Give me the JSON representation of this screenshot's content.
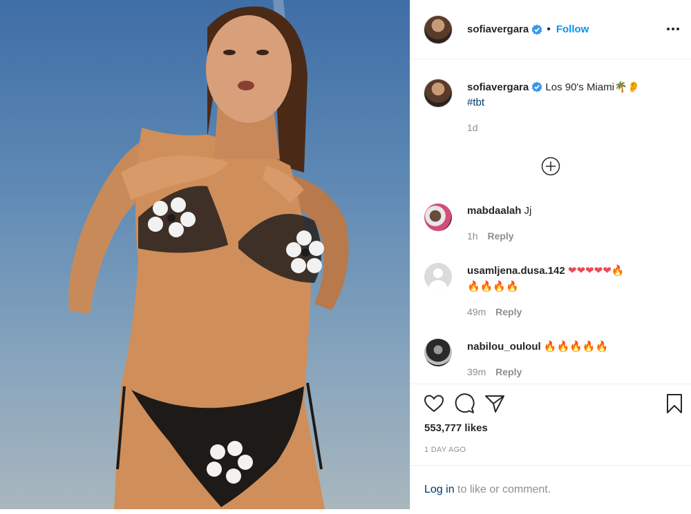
{
  "post": {
    "author": {
      "username": "sofiavergara",
      "verified": true,
      "follow_label": "Follow",
      "separator": "•"
    },
    "caption": {
      "text": "Los 90's Miami",
      "emojis": "🌴👂",
      "hashtag": "#tbt",
      "time": "1d"
    },
    "comments": [
      {
        "username": "mabdaalah",
        "text": "Jj",
        "time": "1h",
        "reply_label": "Reply"
      },
      {
        "username": "usamljena.dusa.142",
        "text": "❤❤❤❤❤🔥",
        "text2": "🔥🔥🔥🔥",
        "time": "49m",
        "reply_label": "Reply"
      },
      {
        "username": "nabilou_ouloul",
        "text": "🔥🔥🔥🔥🔥",
        "time": "39m",
        "reply_label": "Reply"
      }
    ],
    "likes": "553,777 likes",
    "date": "1 DAY AGO",
    "login": {
      "link": "Log in",
      "rest": " to like or comment."
    }
  },
  "colors": {
    "accent": "#0095f6",
    "verified": "#3897f0",
    "hashtag": "#00376b",
    "muted": "#8e8e8e",
    "heart": "#ed4956",
    "fire": "#f77b22"
  },
  "icons": [
    "more-options-icon",
    "verified-badge-icon",
    "load-more-icon",
    "heart-icon",
    "comment-icon",
    "share-icon",
    "bookmark-icon"
  ]
}
